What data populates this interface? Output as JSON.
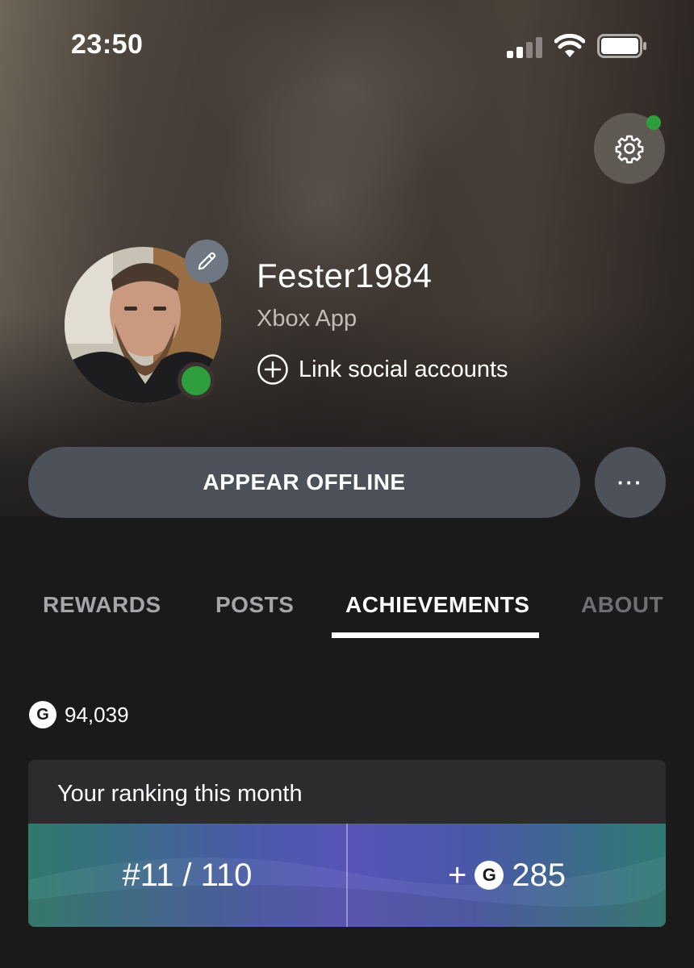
{
  "status_bar": {
    "time": "23:50",
    "icons": [
      "cellular-signal-icon",
      "wifi-icon",
      "battery-icon"
    ]
  },
  "profile": {
    "gamertag": "Fester1984",
    "subtitle": "Xbox App",
    "link_social_label": "Link social accounts",
    "presence_status_color": "#2f9e3d"
  },
  "actions": {
    "appear_offline_label": "APPEAR OFFLINE",
    "more_label": "···"
  },
  "tabs": [
    {
      "label": "REWARDS",
      "active": false
    },
    {
      "label": "POSTS",
      "active": false
    },
    {
      "label": "ACHIEVEMENTS",
      "active": true
    },
    {
      "label": "ABOUT",
      "active": false
    }
  ],
  "achievements": {
    "gamerscore_badge": "G",
    "gamerscore": "94,039",
    "ranking": {
      "header": "Your ranking this month",
      "rank": "#11 / 110",
      "points_prefix": "+",
      "points_badge": "G",
      "points": "285"
    }
  },
  "colors": {
    "background": "#1b1a1b",
    "button_gray": "#4d525a",
    "online_green": "#2f9e3d",
    "ranking_gradient": [
      "#2e7a6c",
      "#5654b8",
      "#2f7a72"
    ]
  }
}
